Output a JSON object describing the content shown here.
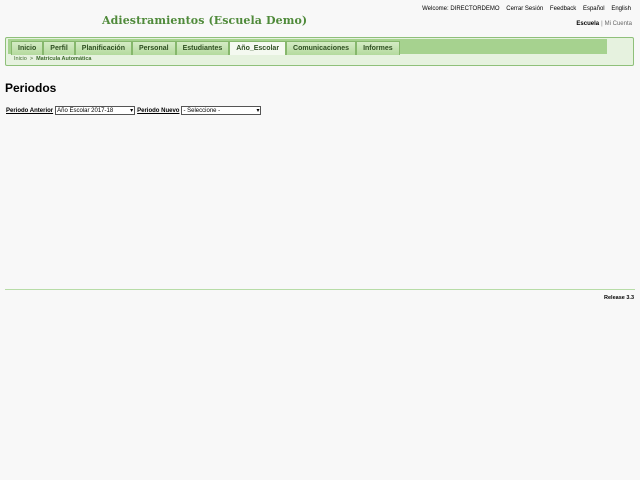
{
  "header": {
    "school_name": "Adiestramientos (Escuela Demo)",
    "top_links": {
      "welcome": "Welcome: DIRECTORDEMO",
      "logout": "Cerrar Sesión",
      "feedback": "Feedback",
      "spanish": "Español",
      "english": "English"
    },
    "role_switch": {
      "active": "Escuela",
      "separator": "|",
      "other": "Mi Cuenta"
    }
  },
  "nav": {
    "tabs": [
      {
        "label": "Inicio"
      },
      {
        "label": "Perfil"
      },
      {
        "label": "Planificación"
      },
      {
        "label": "Personal"
      },
      {
        "label": "Estudiantes"
      },
      {
        "label": "Año_Escolar",
        "active": true
      },
      {
        "label": "Comunicaciones"
      },
      {
        "label": "Informes"
      }
    ],
    "breadcrumb": {
      "home": "Inicio",
      "separator": ">",
      "current": "Matrícula Automática"
    }
  },
  "main": {
    "title": "Periodos",
    "periodo_anterior_label": "Periodo Anterior",
    "periodo_anterior_value": "Año Escolar 2017-18",
    "periodo_nuevo_label": "Periodo Nuevo",
    "periodo_nuevo_value": "- Seleccione -"
  },
  "footer": {
    "release": "Release 3.3"
  },
  "colors": {
    "title_green": "#4f8a3a",
    "nav_bg": "#a6d28f",
    "nav_border": "#86b76c"
  }
}
